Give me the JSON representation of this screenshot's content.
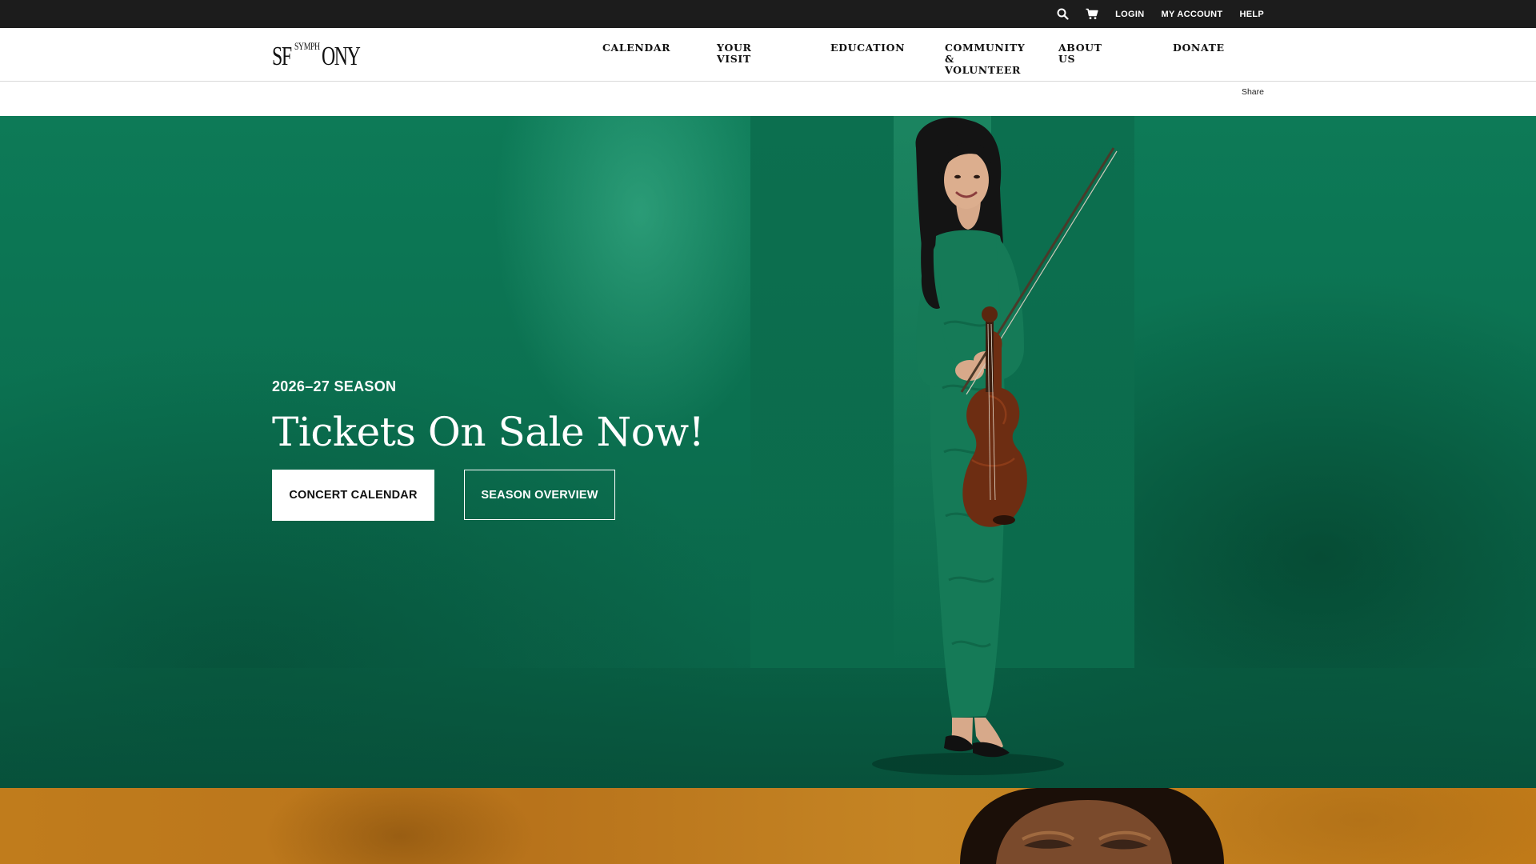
{
  "utility": {
    "search_icon": "search-icon",
    "cart_icon": "cart-icon",
    "login": "LOGIN",
    "my_account": "MY ACCOUNT",
    "help": "HELP"
  },
  "header": {
    "logo_text": "SFSYMPHONY",
    "logo_sf": "SF",
    "logo_symph": "SYMPH",
    "logo_ony": "ONY",
    "nav": [
      {
        "label": "CALENDAR"
      },
      {
        "label": "YOUR VISIT"
      },
      {
        "label": "EDUCATION"
      },
      {
        "label": "COMMUNITY &\nVOLUNTEER"
      },
      {
        "label": "ABOUT US"
      },
      {
        "label": "DONATE"
      }
    ]
  },
  "share": {
    "label": "Share"
  },
  "hero": {
    "eyebrow": "2026–27 SEASON",
    "title": "Tickets On Sale Now!",
    "primary_button": "CONCERT CALENDAR",
    "secondary_button": "SEASON OVERVIEW"
  },
  "colors": {
    "utility_bar": "#1c1c1c",
    "hero_green": "#0b7050",
    "next_section_amber": "#c07c1c"
  }
}
